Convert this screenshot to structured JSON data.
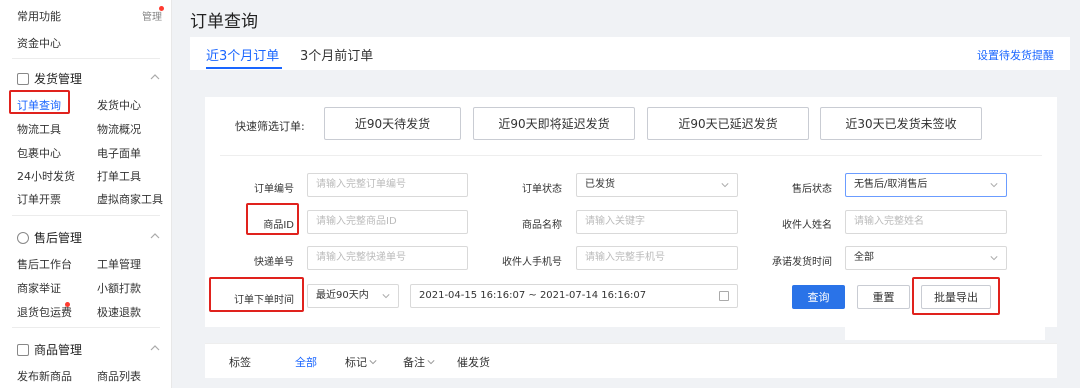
{
  "sidebar": {
    "common": "常用功能",
    "manage": "管理",
    "funds": "资金中心",
    "shipping": {
      "title": "发货管理",
      "items": [
        "订单查询",
        "发货中心",
        "物流工具",
        "物流概况",
        "包裹中心",
        "电子面单",
        "24小时发货",
        "打单工具",
        "订单开票",
        "虚拟商家工具"
      ]
    },
    "aftersale": {
      "title": "售后管理",
      "items": [
        "售后工作台",
        "工单管理",
        "商家举证",
        "小额打款",
        "退货包运费",
        "极速退款"
      ]
    },
    "goods": {
      "title": "商品管理",
      "items": [
        "发布新商品",
        "商品列表"
      ]
    }
  },
  "page": {
    "title": "订单查询",
    "tabs": [
      "近3个月订单",
      "3个月前订单"
    ],
    "tab_link": "设置待发货提醒"
  },
  "quick": {
    "label": "快速筛选订单:",
    "buttons": [
      "近90天待发货",
      "近90天即将延迟发货",
      "近90天已延迟发货",
      "近30天已发货未签收"
    ]
  },
  "form": {
    "order_no": {
      "label": "订单编号",
      "placeholder": "请输入完整订单编号"
    },
    "order_status": {
      "label": "订单状态",
      "value": "已发货"
    },
    "after_status": {
      "label": "售后状态",
      "value": "无售后/取消售后"
    },
    "goods_id": {
      "label": "商品ID",
      "placeholder": "请输入完整商品ID"
    },
    "goods_name": {
      "label": "商品名称",
      "placeholder": "请输入关键字"
    },
    "receiver_name": {
      "label": "收件人姓名",
      "placeholder": "请输入完整姓名"
    },
    "express_no": {
      "label": "快递单号",
      "placeholder": "请输入完整快递单号"
    },
    "receiver_phone": {
      "label": "收件人手机号",
      "placeholder": "请输入完整手机号"
    },
    "promise_time": {
      "label": "承诺发货时间",
      "value": "全部"
    },
    "order_time": {
      "label": "订单下单时间",
      "range": "最近90天内",
      "dates": "2021-04-15 16:16:07 ~ 2021-07-14 16:16:07"
    }
  },
  "actions": {
    "query": "查询",
    "reset": "重置",
    "export": "批量导出"
  },
  "bottom": {
    "tag": "标签",
    "all": "全部",
    "mark": "标记",
    "note": "备注",
    "urge": "催发货"
  },
  "colors": {
    "accent": "#1a66ff",
    "highlight": "#e0221d",
    "primary_btn": "#2a73e8"
  }
}
